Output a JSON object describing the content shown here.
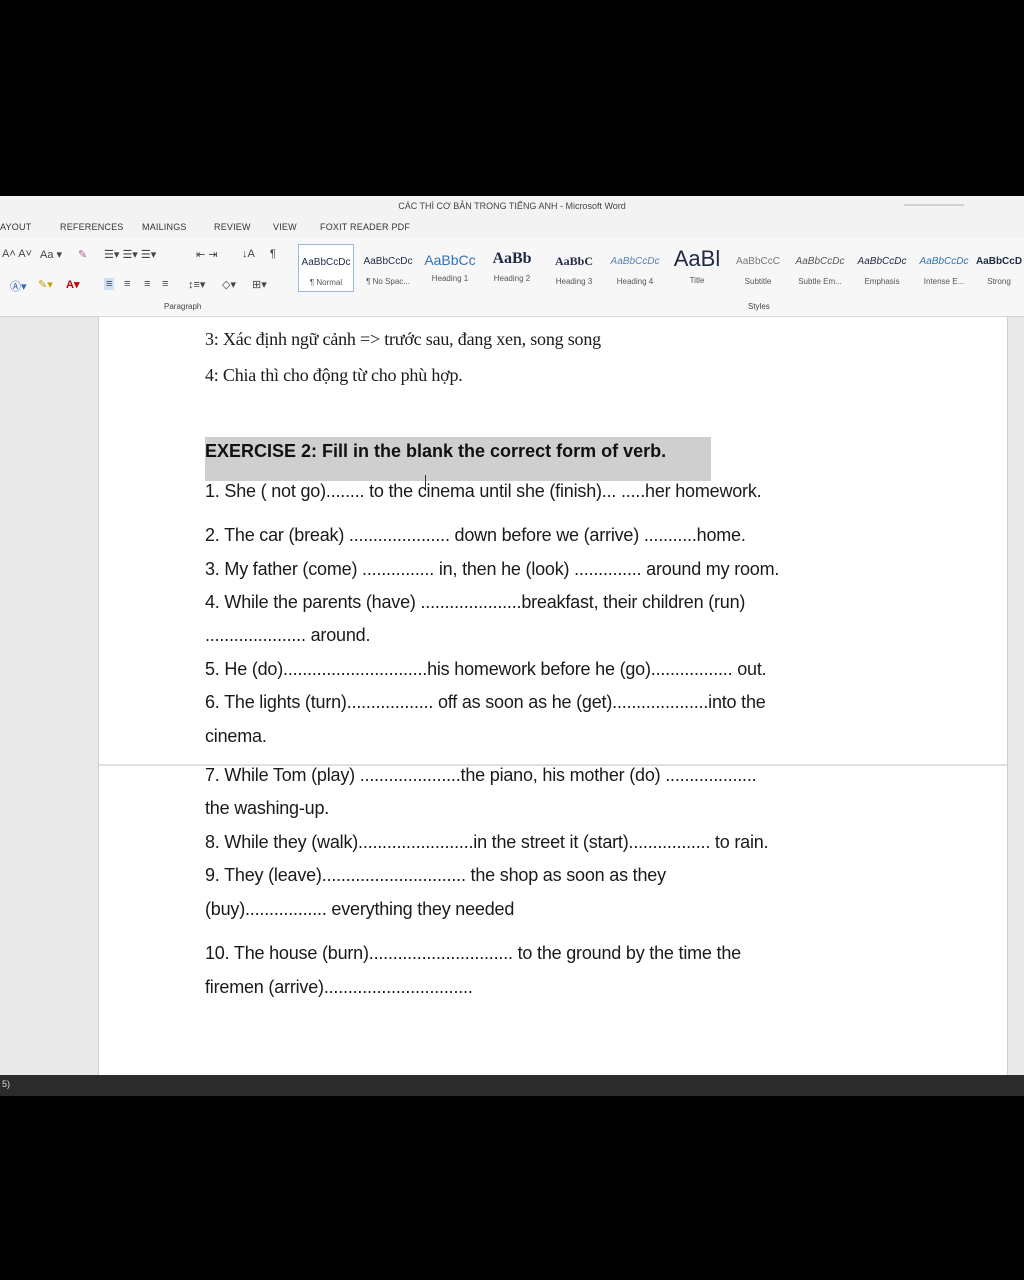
{
  "window": {
    "title": "CÁC THÌ CƠ BẢN TRONG TIẾNG ANH - Microsoft Word"
  },
  "tabs": [
    "AYOUT",
    "REFERENCES",
    "MAILINGS",
    "REVIEW",
    "VIEW",
    "FOXIT READER PDF"
  ],
  "ribbon": {
    "paragraph_label": "Paragraph",
    "styles_label": "Styles",
    "font_size_label": "Aa",
    "styles": [
      {
        "sample": "AaBbCcDc",
        "label": "¶ Normal"
      },
      {
        "sample": "AaBbCcDc",
        "label": "¶ No Spac..."
      },
      {
        "sample": "AaBbCc",
        "label": "Heading 1"
      },
      {
        "sample": "AaBb",
        "label": "Heading 2"
      },
      {
        "sample": "AaBbC",
        "label": "Heading 3"
      },
      {
        "sample": "AaBbCcDc",
        "label": "Heading 4"
      },
      {
        "sample": "AaBl",
        "label": "Title"
      },
      {
        "sample": "AaBbCcC",
        "label": "Subtitle"
      },
      {
        "sample": "AaBbCcDc",
        "label": "Subtle Em..."
      },
      {
        "sample": "AaBbCcDc",
        "label": "Emphasis"
      },
      {
        "sample": "AaBbCcDc",
        "label": "Intense E..."
      },
      {
        "sample": "AaBbCcD",
        "label": "Strong"
      }
    ]
  },
  "document": {
    "intro": [
      "3: Xác định ngữ cảnh => trước sau, đang xen, song song",
      "4: Chia thì cho động từ cho phù hợp."
    ],
    "heading": "EXERCISE 2: Fill in the blank the correct form of verb.",
    "lines": [
      "1. She ( not go)........ to the cinema until she (finish)... .....her homework.",
      "2. The car (break) ..................... down before we (arrive) ...........home.",
      "3. My father (come) ............... in, then he (look) .............. around my room.",
      "4. While the parents (have) .....................breakfast, their children (run)",
      "..................... around.",
      "5. He (do)..............................his homework before he (go)................. out.",
      "6. The lights (turn).................. off as soon as he (get)....................into the",
      "cinema.",
      "7. While Tom (play) .....................the piano, his mother (do) ...................",
      "the washing-up.",
      "8. While they (walk)........................in the street it (start)................. to rain.",
      "9. They (leave).............................. the shop as soon as they",
      "(buy)................. everything they needed",
      "10. The house (burn).............................. to the ground by the time the",
      "firemen (arrive)..............................."
    ]
  },
  "status": {
    "text": "5)"
  }
}
